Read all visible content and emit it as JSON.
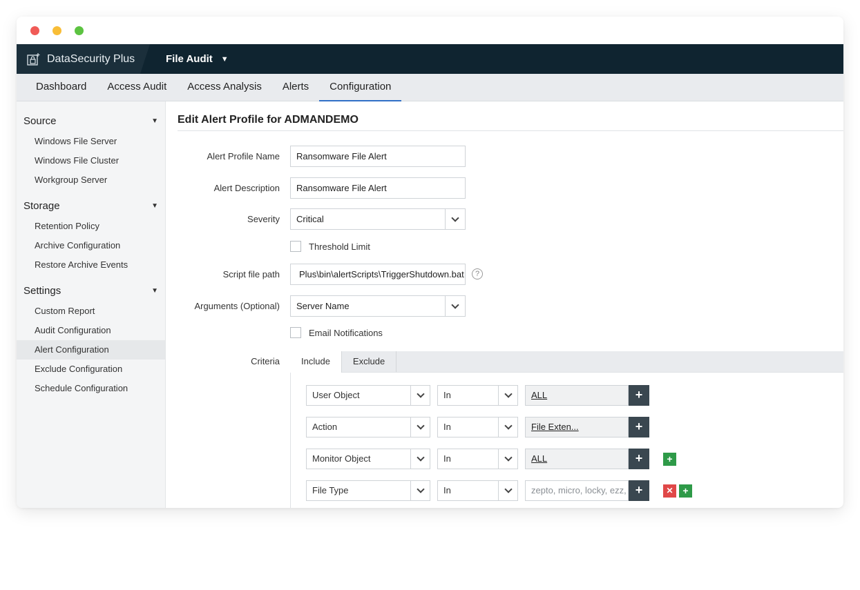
{
  "app": {
    "brand": "DataSecurity Plus",
    "product": "File Audit"
  },
  "nav": {
    "tabs": [
      "Dashboard",
      "Access Audit",
      "Access Analysis",
      "Alerts",
      "Configuration"
    ],
    "active": "Configuration"
  },
  "sidebar": {
    "sections": [
      {
        "title": "Source",
        "items": [
          "Windows File Server",
          "Windows File Cluster",
          "Workgroup Server"
        ]
      },
      {
        "title": "Storage",
        "items": [
          "Retention Policy",
          "Archive Configuration",
          "Restore Archive Events"
        ]
      },
      {
        "title": "Settings",
        "items": [
          "Custom Report",
          "Audit Configuration",
          "Alert Configuration",
          "Exclude Configuration",
          "Schedule Configuration"
        ]
      }
    ],
    "active_item": "Alert Configuration"
  },
  "form": {
    "title": "Edit Alert Profile for ADMANDEMO",
    "profile_name_label": "Alert Profile Name",
    "profile_name_value": "Ransomware File Alert",
    "description_label": "Alert Description",
    "description_value": "Ransomware File Alert",
    "severity_label": "Severity",
    "severity_value": "Critical",
    "threshold_label": "Threshold Limit",
    "threshold_checked": false,
    "script_label": "Script file path",
    "script_value": "Plus\\bin\\alertScripts\\TriggerShutdown.bat",
    "help_glyph": "?",
    "arguments_label": "Arguments (Optional)",
    "arguments_value": "Server Name",
    "email_label": "Email Notifications",
    "email_checked": false,
    "criteria_label": "Criteria",
    "criteria_tabs": [
      "Include",
      "Exclude"
    ],
    "criteria_active_tab": "Include",
    "criteria_rows": [
      {
        "field": "User Object",
        "operator": "In",
        "value": "ALL"
      },
      {
        "field": "Action",
        "operator": "In",
        "value": "File Exten..."
      },
      {
        "field": "Monitor Object",
        "operator": "In",
        "value": "ALL"
      },
      {
        "field": "File Type",
        "operator": "In",
        "value_placeholder": "zepto, micro, locky, ezz,"
      }
    ],
    "plus_glyph": "+",
    "remove_glyph": "✕"
  },
  "colors": {
    "topbar": "#0f2430",
    "accent": "#2f6fc7",
    "add_green": "#2e9a48",
    "remove_red": "#e04848"
  }
}
